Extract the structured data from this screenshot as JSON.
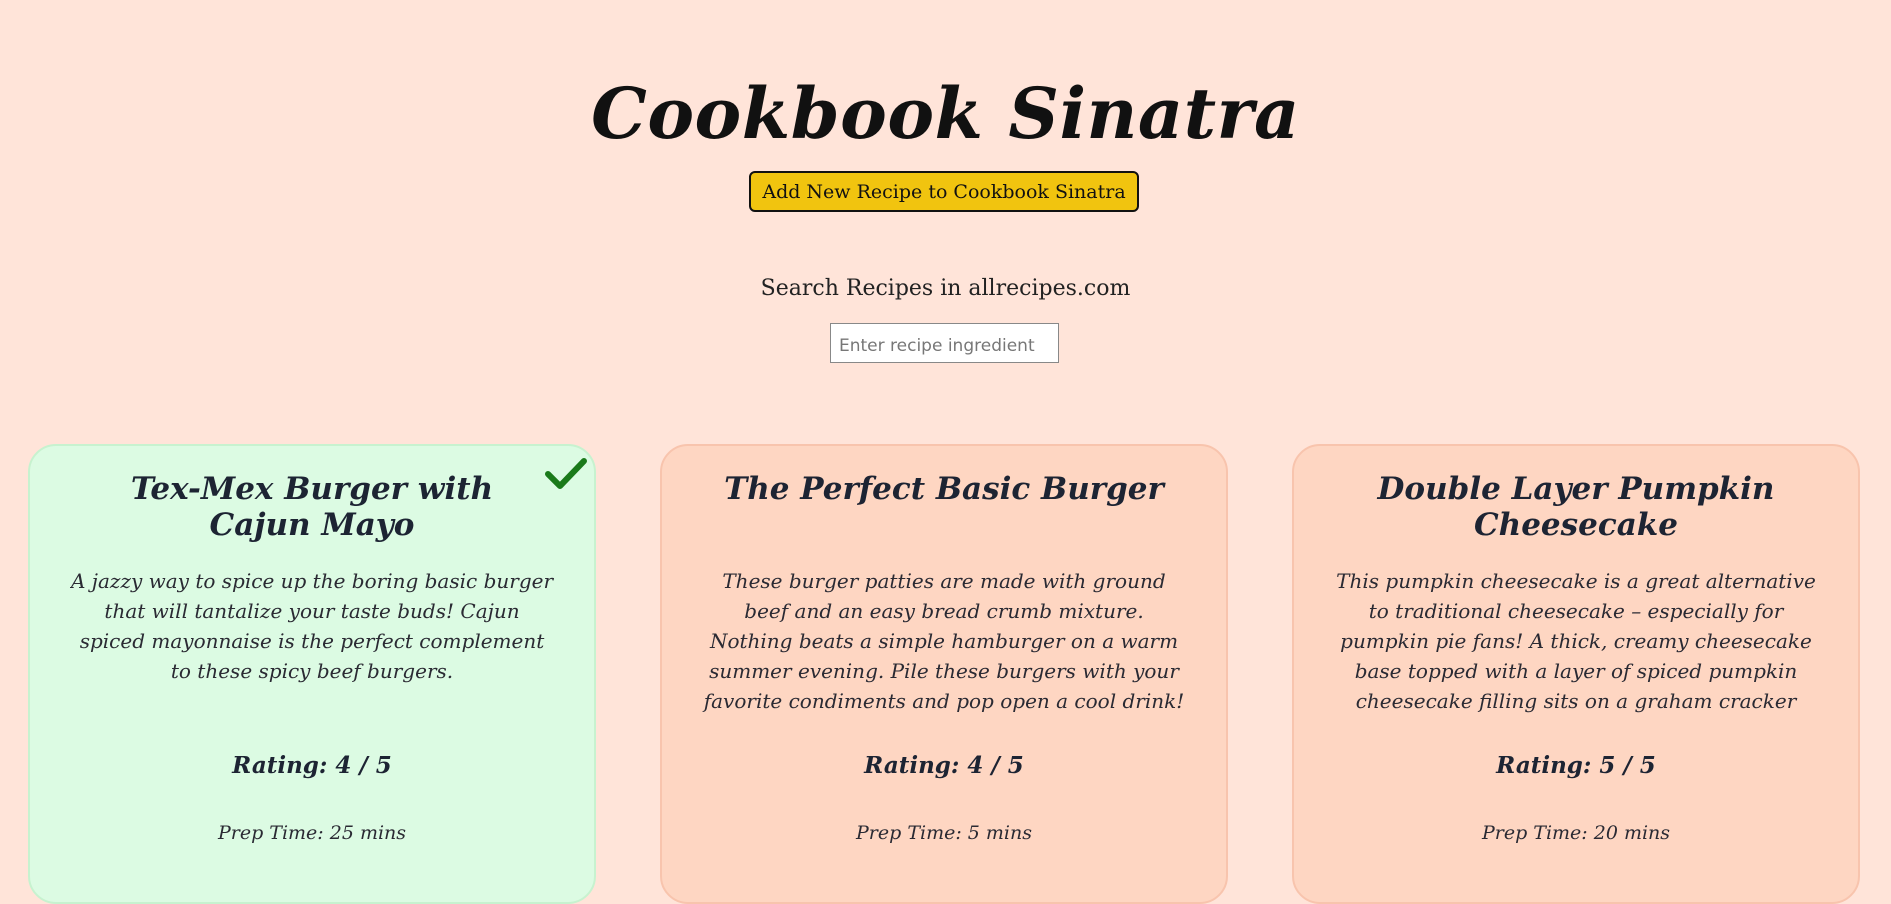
{
  "app": {
    "title": "Cookbook Sinatra"
  },
  "actions": {
    "add_label": "Add New Recipe to Cookbook Sinatra"
  },
  "search": {
    "label": "Search Recipes in allrecipes.com",
    "placeholder": "Enter recipe ingredient",
    "value": ""
  },
  "recipes": [
    {
      "title": "Tex-Mex Burger with Cajun Mayo",
      "description": "A jazzy way to spice up the boring basic burger that will tantalize your taste buds! Cajun spiced mayonnaise is the perfect complement to these spicy beef burgers.",
      "rating": "Rating: 4 / 5",
      "prep_time": "Prep Time: 25 mins",
      "selected": true,
      "status_icon": "check-icon"
    },
    {
      "title": "The Perfect Basic Burger",
      "description": "These burger patties are made with ground beef and an easy bread crumb mixture. Nothing beats a simple hamburger on a warm summer evening. Pile these burgers with your favorite condiments and pop open a cool drink!",
      "rating": "Rating: 4 / 5",
      "prep_time": "Prep Time: 5 mins",
      "selected": false
    },
    {
      "title": "Double Layer Pumpkin Cheesecake",
      "description": "This pumpkin cheesecake is a great alternative to traditional cheesecake – especially for pumpkin pie fans! A thick, creamy cheesecake base topped with a layer of spiced pumpkin cheesecake filling sits on a graham cracker crust in this easy layered holiday",
      "rating": "Rating: 5 / 5",
      "prep_time": "Prep Time: 20 mins",
      "selected": false
    }
  ],
  "colors": {
    "page_background": "#ffe4d9",
    "card_background": "#fed6c2",
    "card_selected_background": "#dcfbe3",
    "button_background": "#f1c40f",
    "check_color": "#1a7a1a"
  }
}
